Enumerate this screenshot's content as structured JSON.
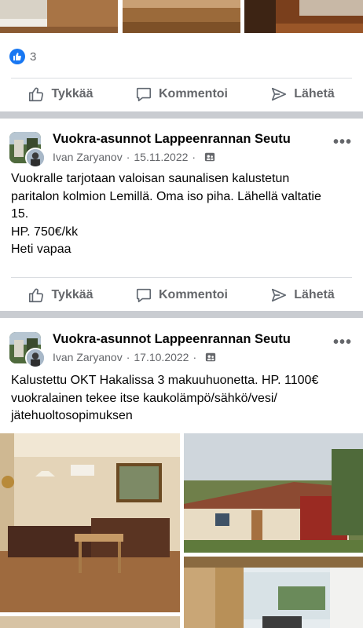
{
  "reactions": {
    "count": "3",
    "icon": "like-icon"
  },
  "action_labels": {
    "like": "Tykkää",
    "comment": "Kommentoi",
    "send": "Lähetä"
  },
  "posts": [
    {
      "group": "Vuokra-asunnot Lappeenrannan Seutu",
      "author": "",
      "date": "15.11.2022",
      "lines": [
        "Vuokralle tarjotaan valoisan saunalisen kalustetun",
        "paritalon kolmion Lemillä. Oma iso piha. Lähellä valtatie",
        "15.",
        "HP. 750€/kk",
        "Heti vapaa"
      ]
    },
    {
      "group": "Vuokra-asunnot Lappeenrannan Seutu",
      "author": "Ivan Zaryanov",
      "date": "17.10.2022",
      "lines": [
        "Kalustettu OKT Hakalissa 3 makuuhuonetta. HP. 1100€",
        "vuokralainen tekee itse kaukolämpö/sähkö/vesi/",
        "jätehuoltosopimuksen"
      ]
    }
  ],
  "post1_author": "Ivan Zaryanov",
  "meta_dot": "·",
  "more_glyph": "•••",
  "colors": {
    "brand": "#1877f2",
    "secondary_text": "#65676b",
    "divider": "#c9ccd1"
  }
}
